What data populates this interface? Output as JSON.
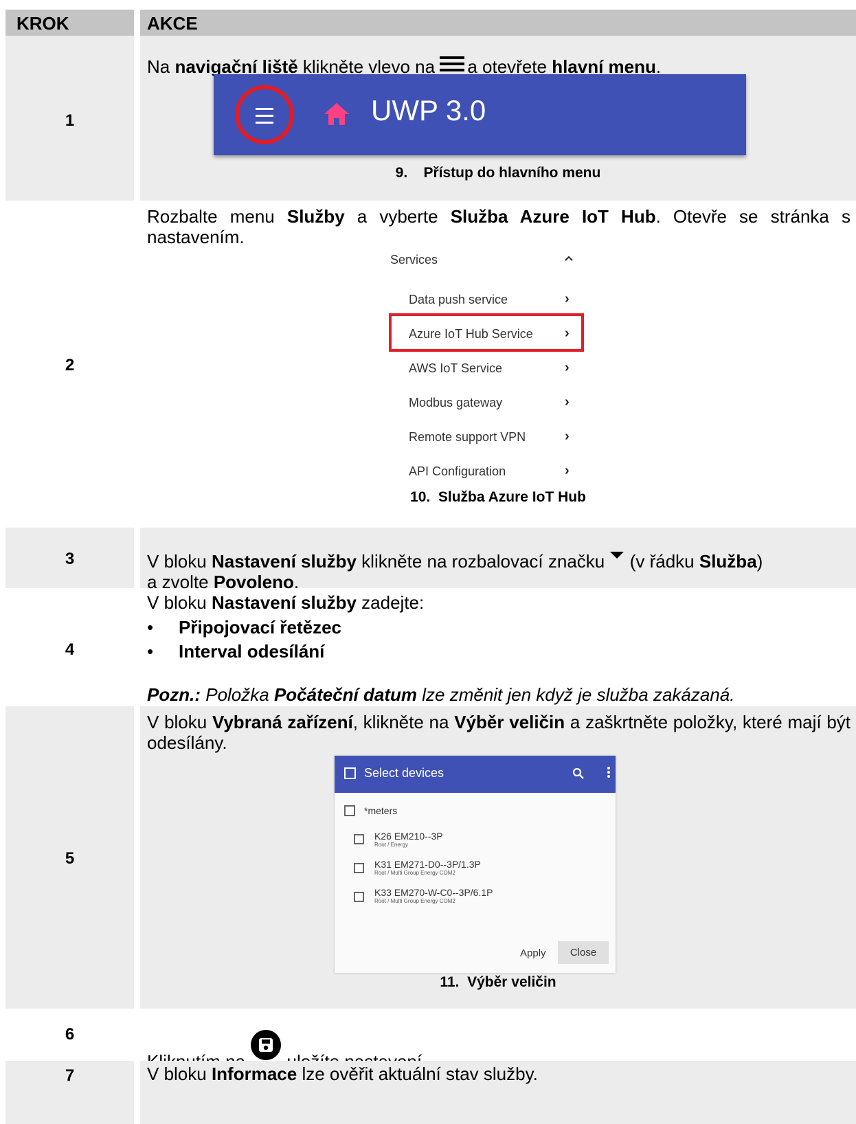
{
  "header": {
    "col_step": "KROK",
    "col_action": "AKCE"
  },
  "step1": {
    "number": "1",
    "t_a": "Na ",
    "t_b": "navigační liště",
    "t_c": " klikněte vlevo na ",
    "t_d": "a otevřete ",
    "t_e": "hlavní menu",
    "t_f": ".",
    "navbar": {
      "title": "UWP 3.0",
      "menu_icon": "hamburger-menu-icon",
      "home_icon": "home-icon",
      "accent": "#3f51b5",
      "highlight": "#e31b23",
      "home_color": "#ff4081"
    },
    "caption": "9.    Přístup do hlavního menu"
  },
  "step2": {
    "number": "2",
    "t_a": "Rozbalte menu ",
    "t_b": "Služby",
    "t_c": " a vyberte ",
    "t_d": "Služba Azure IoT Hub",
    "t_e": ". Otevře se stránka s nastavením.",
    "menu": {
      "header": "Services",
      "items": [
        "Data push service",
        "Azure IoT Hub Service",
        "AWS IoT Service",
        "Modbus gateway",
        "Remote support VPN",
        "API Configuration"
      ],
      "selected": "Azure IoT Hub Service",
      "highlight": "#e0202b"
    },
    "caption": "10.  Služba Azure IoT Hub"
  },
  "step3": {
    "number": "3",
    "t_a": "V bloku ",
    "t_b": "Nastavení služby",
    "t_c": " klikněte na rozbalovací značku ",
    "t_d": " (v řádku ",
    "t_e": "Služba",
    "t_f": ")",
    "t_g": "a zvolte ",
    "t_h": "Povoleno",
    "t_i": "."
  },
  "step4": {
    "number": "4",
    "t_a": "V bloku ",
    "t_b": "Nastavení služby",
    "t_c": " zadejte:",
    "bullets": [
      "Připojovací řetězec",
      "Interval odesílání"
    ],
    "note_a": "Pozn.:",
    "note_b": " Položka ",
    "note_c": "Počáteční datum",
    "note_d": " lze změnit jen když je služba zakázaná."
  },
  "step5": {
    "number": "5",
    "t_a": "V bloku ",
    "t_b": "Vybraná zařízení",
    "t_c": ", klikněte na ",
    "t_d": "Výběr veličin",
    "t_e": " a zaškrtněte položky, které mají být odesílány.",
    "dialog": {
      "title": "Select devices",
      "group": "*meters",
      "devices": [
        {
          "name": "K26 EM210--3P",
          "path": "Root / Energy"
        },
        {
          "name": "K31 EM271-D0--3P/1.3P",
          "path": "Root / Multi Group Energy COM2"
        },
        {
          "name": "K33 EM270-W-C0--3P/6.1P",
          "path": "Root / Multi Group Energy COM2"
        }
      ],
      "apply": "Apply",
      "close": "Close"
    },
    "caption": "11.  Výběr veličin"
  },
  "step6": {
    "number": "6",
    "t_a": "Kliknutím na ",
    "t_b": " uložíte nastavení.",
    "icon": "save-icon"
  },
  "step7": {
    "number": "7",
    "t_a": "V bloku ",
    "t_b": "Informace",
    "t_c": " lze ověřit aktuální stav služby."
  }
}
